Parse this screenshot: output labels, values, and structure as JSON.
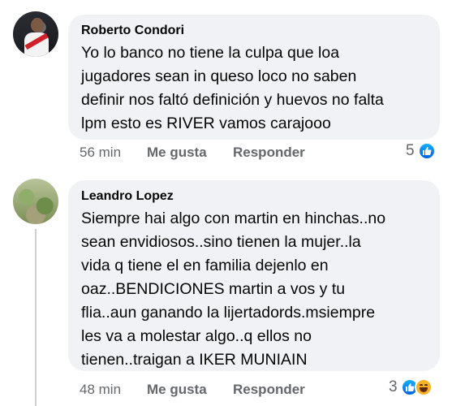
{
  "comments": [
    {
      "author": "Roberto Condori",
      "text": "Yo lo banco no tiene la culpa que loa\njugadores sean in queso loco no saben\ndefinir nos faltó definición y huevos no falta\nlpm esto es RIVER vamos carajooo",
      "time": "56 min",
      "like_label": "Me gusta",
      "reply_label": "Responder",
      "reaction_count": "5",
      "reactions": [
        "like-icon"
      ]
    },
    {
      "author": "Leandro Lopez",
      "text": "Siempre hai algo con martin en hinchas..no\nsean envidiosos..sino tienen la mujer..la\nvida q tiene el en familia dejenlo en\noaz..BENDICIONES  martin a vos y tu\nflia..aun ganando la lijertadords.msiempre\nles va a molestar algo..q ellos no\ntienen..traigan a IKER MUNIAIN",
      "time": "48 min",
      "like_label": "Me gusta",
      "reply_label": "Responder",
      "reaction_count": "3",
      "reactions": [
        "like-icon",
        "haha-icon"
      ]
    }
  ],
  "colors": {
    "bubble": "#f0f2f5",
    "secondary_text": "#65676b",
    "like_blue": "#0866ff",
    "haha_yellow": "#f7b125"
  }
}
